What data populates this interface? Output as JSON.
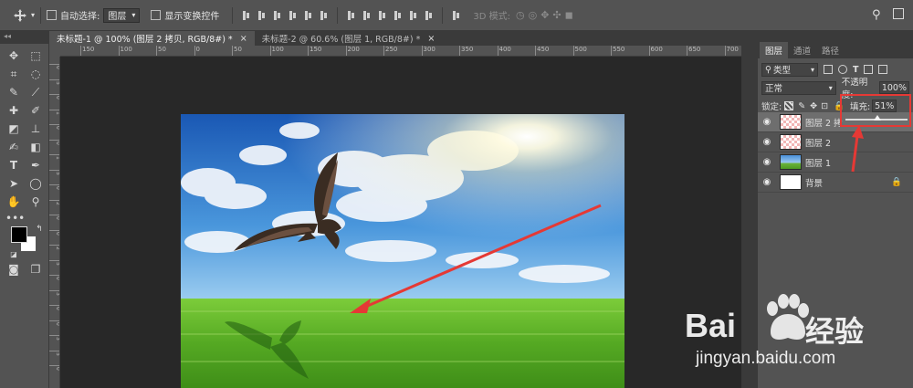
{
  "options_bar": {
    "auto_select_label": "自动选择:",
    "auto_select_value": "图层",
    "show_transform_label": "显示变换控件",
    "mode_3d_label": "3D 模式:"
  },
  "tabs": [
    {
      "label": "未标题-1 @ 100% (图层 2 拷贝, RGB/8#) *",
      "close": "×"
    },
    {
      "label": "未标题-2 @ 60.6% (图层 1, RGB/8#) *",
      "close": "×"
    }
  ],
  "ruler_top": [
    "150",
    "100",
    "50",
    "0",
    "50",
    "100",
    "150",
    "200",
    "250",
    "300",
    "350",
    "400",
    "450",
    "500",
    "550",
    "600",
    "650",
    "700"
  ],
  "ruler_left": [
    "0",
    "5",
    "0",
    "1",
    "0",
    "0",
    "1",
    "5",
    "0",
    "2",
    "0",
    "0",
    "2",
    "5",
    "0",
    "3",
    "0",
    "0",
    "3",
    "5",
    "0"
  ],
  "panel": {
    "tabs": [
      "图层",
      "通道",
      "路径"
    ],
    "kind_label": "类型",
    "blend_mode": "正常",
    "opacity_label": "不透明度:",
    "opacity_value": "100%",
    "lock_label": "锁定:",
    "fill_label": "填充:",
    "fill_value": "51%",
    "fill_slider_value": 0.51,
    "layers": [
      {
        "name": "图层 2 拷",
        "selected": true,
        "thumb": "transparent"
      },
      {
        "name": "图层 2",
        "selected": false,
        "thumb": "transparent"
      },
      {
        "name": "图层 1",
        "selected": false,
        "thumb": "sky"
      },
      {
        "name": "背景",
        "selected": false,
        "thumb": "white",
        "locked": true
      }
    ]
  },
  "watermark": {
    "brand": "Bai",
    "brand_suffix": "经验",
    "url": "jingyan.baidu.com"
  },
  "colors": {
    "annotation_red": "#e53935",
    "panel_bg": "#535353",
    "workspace_bg": "#282828"
  }
}
